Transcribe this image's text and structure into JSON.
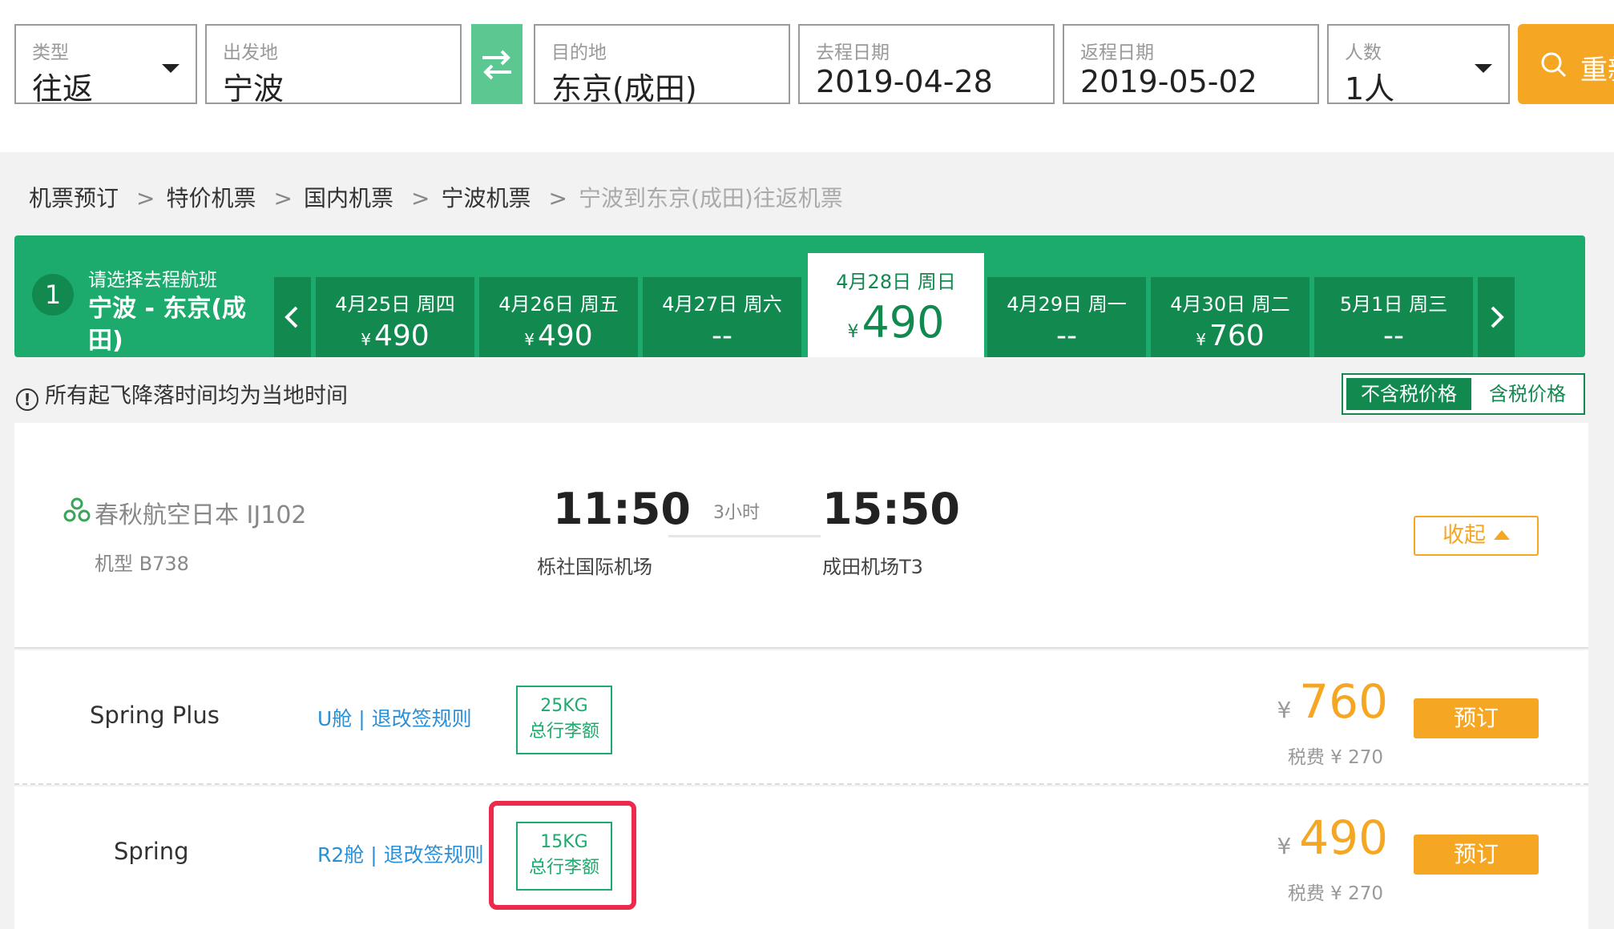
{
  "search": {
    "type_label": "类型",
    "type_value": "往返",
    "from_label": "出发地",
    "from_value": "宁波",
    "to_label": "目的地",
    "to_value": "东京(成田)",
    "depart_label": "去程日期",
    "depart_value": "2019-04-28",
    "return_label": "返程日期",
    "return_value": "2019-05-02",
    "pax_label": "人数",
    "pax_value": "1人",
    "search_button": "重新"
  },
  "breadcrumb": {
    "items": [
      "机票预订",
      "特价机票",
      "国内机票",
      "宁波机票"
    ],
    "current": "宁波到东京(成田)往返机票",
    "separator": ">"
  },
  "date_strip": {
    "step": "1",
    "title": "请选择去程航班",
    "route": "宁波 - 东京(成田)",
    "currency": "¥",
    "days": [
      {
        "date": "4月25日 周四",
        "price": "490"
      },
      {
        "date": "4月26日 周五",
        "price": "490"
      },
      {
        "date": "4月27日 周六",
        "price": "--"
      },
      {
        "date": "4月28日 周日",
        "price": "490"
      },
      {
        "date": "4月29日 周一",
        "price": "--"
      },
      {
        "date": "4月30日 周二",
        "price": "760"
      },
      {
        "date": "5月1日 周三",
        "price": "--"
      }
    ]
  },
  "notice": {
    "icon": "!",
    "text": "所有起飞降落时间均为当地时间"
  },
  "tax_toggle": {
    "excl": "不含税价格",
    "incl": "含税价格"
  },
  "flight": {
    "airline": "春秋航空日本 IJ102",
    "aircraft": "机型 B738",
    "dep_time": "11:50",
    "dep_airport": "栎社国际机场",
    "duration": "3小时",
    "arr_time": "15:50",
    "arr_airport": "成田机场T3",
    "collapse_label": "收起"
  },
  "fares": [
    {
      "name": "Spring Plus",
      "rule": "U舱 | 退改签规则",
      "bag_weight": "25KG",
      "bag_label": "总行李额",
      "currency": "¥",
      "price": "760",
      "tax": "税费 ¥ 270",
      "book": "预订"
    },
    {
      "name": "Spring",
      "rule": "R2舱 | 退改签规则",
      "bag_weight": "15KG",
      "bag_label": "总行李额",
      "currency": "¥",
      "price": "490",
      "tax": "税费 ¥ 270",
      "book": "预订"
    }
  ],
  "colors": {
    "brand_green": "#1cab6c",
    "dark_green": "#11894f",
    "accent_orange": "#f5a623",
    "link_blue": "#2b8fd6",
    "highlight_red": "#ec2a4c"
  }
}
